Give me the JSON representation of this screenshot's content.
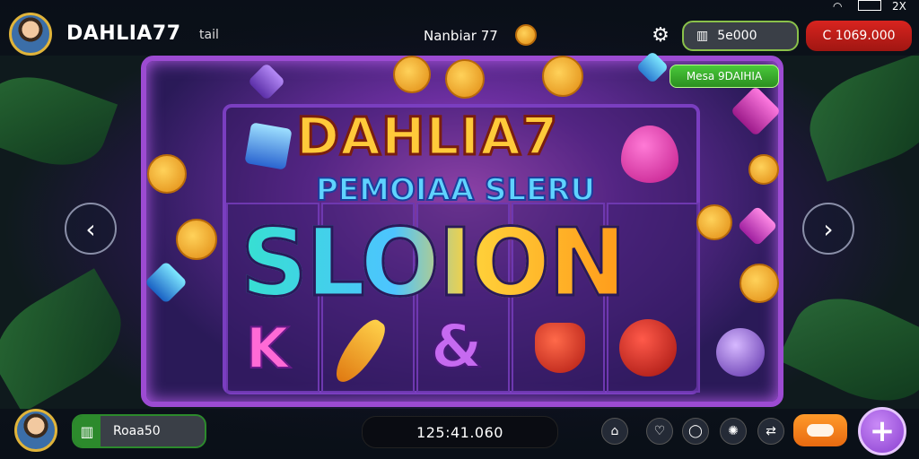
{
  "status_bar": {
    "battery_label": "2X"
  },
  "header": {
    "brand": "DAHLIA77",
    "brand_suffix": "tail",
    "center_title": "Nanbiar 77",
    "credits_value": "5e000",
    "bonus_value": "C 1069.000"
  },
  "promo_badge": "Mesa 9DAIHIA",
  "game": {
    "logo_line1": "DAHLIA7",
    "logo_line2": "PEMOIAA SLERU",
    "logo_line3": "SLOION",
    "reel_symbols": [
      "K",
      "carrot",
      "&",
      "pepper",
      "apple"
    ],
    "side_left_glyph": "‹",
    "side_right_glyph": "›"
  },
  "footer": {
    "balance_label": "Roaa50",
    "win_display": "125:41.060",
    "plus_label": "+"
  },
  "icons": [
    "gear-icon",
    "building-icon",
    "wifi-icon",
    "battery-icon",
    "chevron-left-icon",
    "chevron-right-icon",
    "home-icon",
    "heart-icon",
    "bag-icon",
    "star-icon",
    "shuffle-icon",
    "plus-icon"
  ],
  "colors": {
    "accent": "#9c4bd2",
    "bonus": "#d8241f",
    "balance": "#2c8a2c",
    "plus": "#8a3fd0",
    "orange": "#ff9a2a"
  }
}
